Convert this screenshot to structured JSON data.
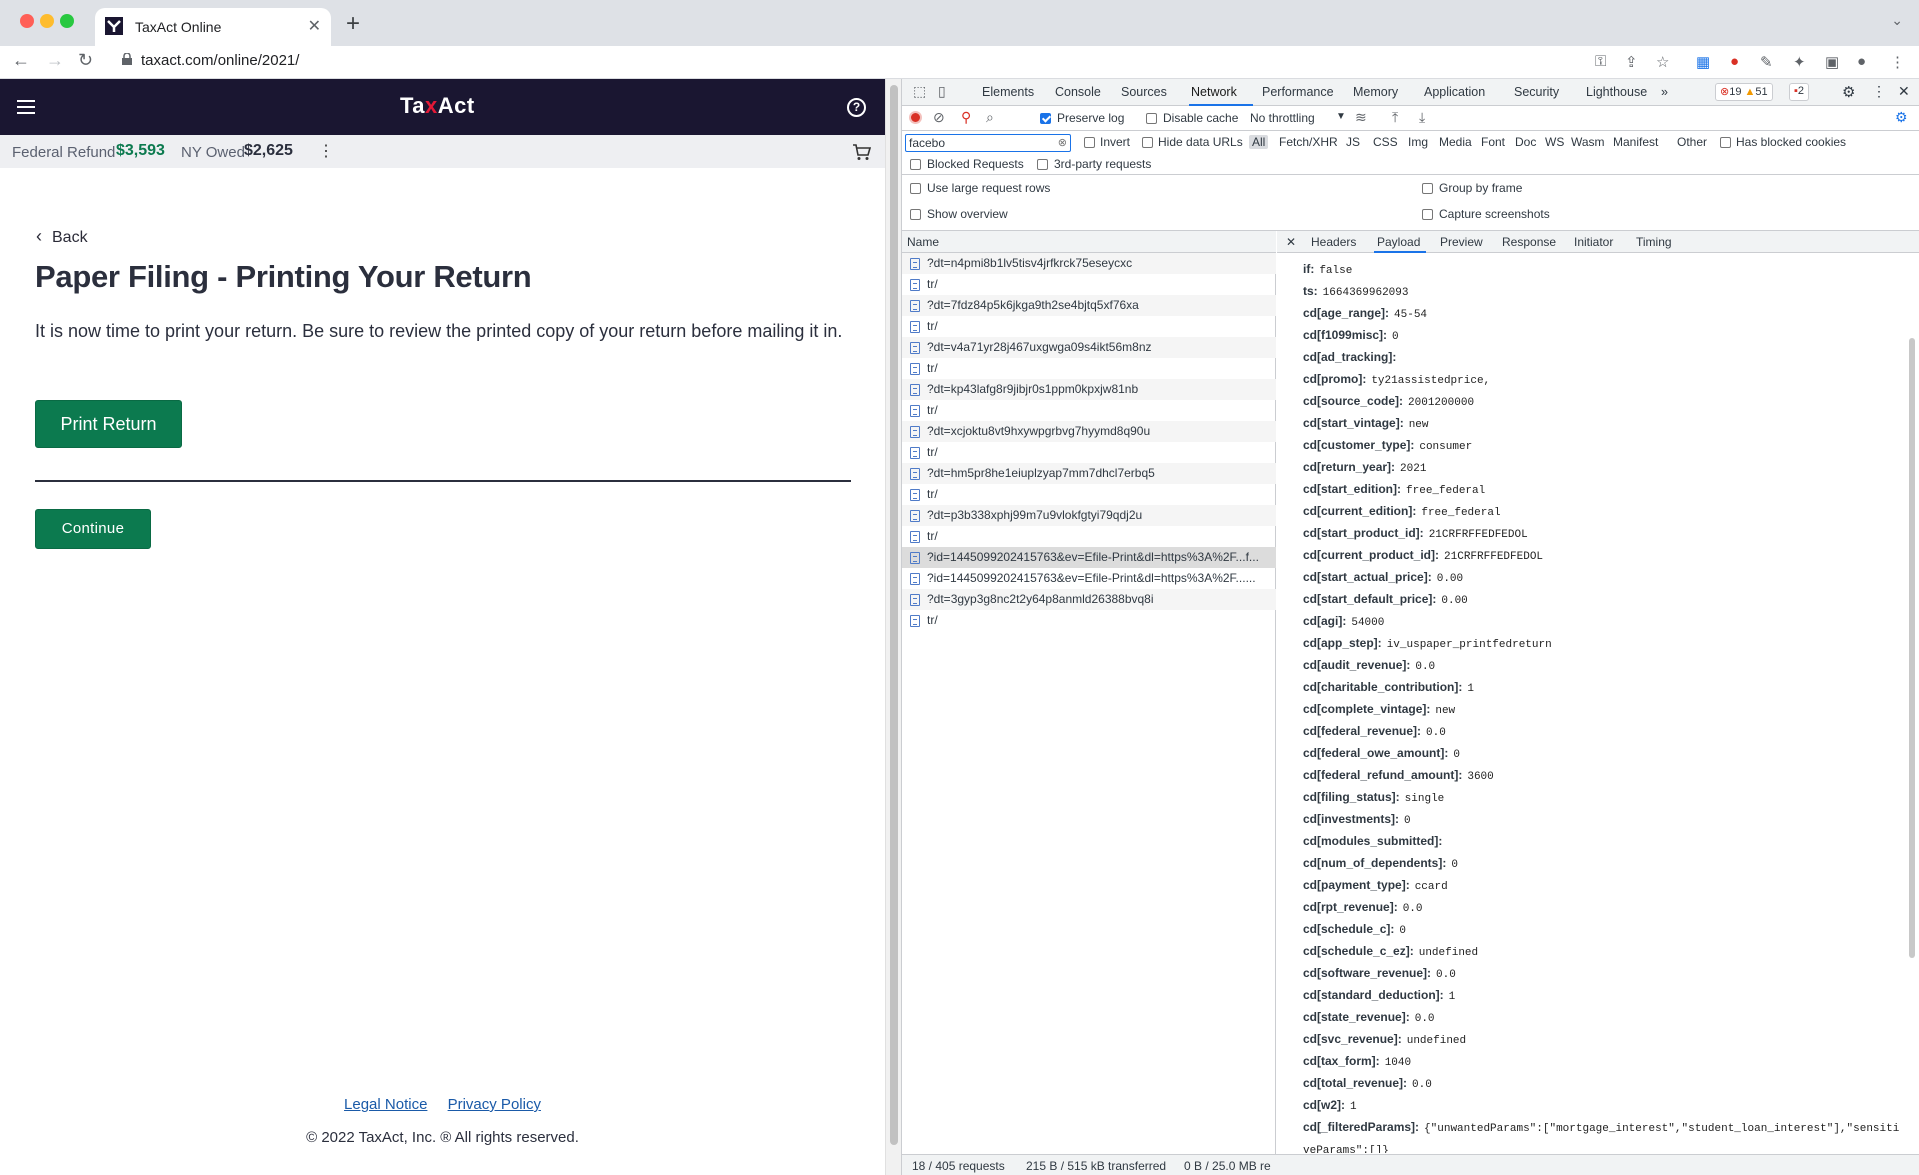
{
  "browser": {
    "tab_title": "TaxAct Online",
    "url": "taxact.com/online/2021/"
  },
  "page": {
    "logo": {
      "part1": "Ta",
      "part2": "x",
      "part3": "Act"
    },
    "federal_refund_label": "Federal Refund",
    "federal_refund_amount": "$3,593",
    "ny_label": "NY Owed",
    "ny_amount": "$2,625",
    "back_label": "Back",
    "title": "Paper Filing - Printing Your Return",
    "intro": "It is now time to print your return. Be sure to review the printed copy of your return before mailing it in.",
    "print_button": "Print Return",
    "continue_button": "Continue",
    "legal_notice": "Legal Notice",
    "privacy_policy": "Privacy Policy",
    "copyright": "© 2022 TaxAct, Inc. ® All rights reserved.",
    "colors": {
      "header": "#1a1631",
      "button": "#0c7a4f",
      "refund": "#0c7a4f"
    }
  },
  "devtools": {
    "tabs": [
      "Elements",
      "Console",
      "Sources",
      "Network",
      "Performance",
      "Memory",
      "Application",
      "Security",
      "Lighthouse"
    ],
    "active_tab": "Network",
    "errors": "19",
    "warnings": "51",
    "issues": "2",
    "preserve_log": "Preserve log",
    "disable_cache": "Disable cache",
    "throttling": "No throttling",
    "filter_value": "facebo",
    "invert": "Invert",
    "hide_data_urls": "Hide data URLs",
    "filter_types": [
      "All",
      "Fetch/XHR",
      "JS",
      "CSS",
      "Img",
      "Media",
      "Font",
      "Doc",
      "WS",
      "Wasm",
      "Manifest",
      "Other"
    ],
    "has_blocked_cookies": "Has blocked cookies",
    "blocked_requests": "Blocked Requests",
    "third_party": "3rd-party requests",
    "large_rows": "Use large request rows",
    "group_by_frame": "Group by frame",
    "show_overview": "Show overview",
    "capture_screenshots": "Capture screenshots",
    "name_header": "Name",
    "requests": [
      "?dt=n4pmi8b1lv5tisv4jrfkrck75eseycxc",
      "tr/",
      "?dt=7fdz84p5k6jkga9th2se4bjtq5xf76xa",
      "tr/",
      "?dt=v4a71yr28j467uxgwga09s4ikt56m8nz",
      "tr/",
      "?dt=kp43lafg8r9jibjr0s1ppm0kpxjw81nb",
      "tr/",
      "?dt=xcjoktu8vt9hxywpgrbvg7hyymd8q90u",
      "tr/",
      "?dt=hm5pr8he1eiuplzyap7mm7dhcl7erbq5",
      "tr/",
      "?dt=p3b338xphj99m7u9vlokfgtyi79qdj2u",
      "tr/",
      "?id=1445099202415763&ev=Efile-Print&dl=https%3A%2F...f...",
      "?id=1445099202415763&ev=Efile-Print&dl=https%3A%2F......",
      "?dt=3gyp3g8nc2t2y64p8anmld26388bvq8i",
      "tr/"
    ],
    "detail_tabs": [
      "Headers",
      "Payload",
      "Preview",
      "Response",
      "Initiator",
      "Timing"
    ],
    "active_detail_tab": "Payload",
    "payload": [
      [
        "if:",
        "false"
      ],
      [
        "ts:",
        "1664369962093"
      ],
      [
        "cd[age_range]:",
        "45-54"
      ],
      [
        "cd[f1099misc]:",
        "0"
      ],
      [
        "cd[ad_tracking]:",
        ""
      ],
      [
        "cd[promo]:",
        "ty21assistedprice,"
      ],
      [
        "cd[source_code]:",
        "2001200000"
      ],
      [
        "cd[start_vintage]:",
        "new"
      ],
      [
        "cd[customer_type]:",
        "consumer"
      ],
      [
        "cd[return_year]:",
        "2021"
      ],
      [
        "cd[start_edition]:",
        "free_federal"
      ],
      [
        "cd[current_edition]:",
        "free_federal"
      ],
      [
        "cd[start_product_id]:",
        "21CRFRFFEDFEDOL"
      ],
      [
        "cd[current_product_id]:",
        "21CRFRFFEDFEDOL"
      ],
      [
        "cd[start_actual_price]:",
        "0.00"
      ],
      [
        "cd[start_default_price]:",
        "0.00"
      ],
      [
        "cd[agi]:",
        "54000"
      ],
      [
        "cd[app_step]:",
        "iv_uspaper_printfedreturn"
      ],
      [
        "cd[audit_revenue]:",
        "0.0"
      ],
      [
        "cd[charitable_contribution]:",
        "1"
      ],
      [
        "cd[complete_vintage]:",
        "new"
      ],
      [
        "cd[federal_revenue]:",
        "0.0"
      ],
      [
        "cd[federal_owe_amount]:",
        "0"
      ],
      [
        "cd[federal_refund_amount]:",
        "3600"
      ],
      [
        "cd[filing_status]:",
        "single"
      ],
      [
        "cd[investments]:",
        "0"
      ],
      [
        "cd[modules_submitted]:",
        ""
      ],
      [
        "cd[num_of_dependents]:",
        "0"
      ],
      [
        "cd[payment_type]:",
        "ccard"
      ],
      [
        "cd[rpt_revenue]:",
        "0.0"
      ],
      [
        "cd[schedule_c]:",
        "0"
      ],
      [
        "cd[schedule_c_ez]:",
        "undefined"
      ],
      [
        "cd[software_revenue]:",
        "0.0"
      ],
      [
        "cd[standard_deduction]:",
        "1"
      ],
      [
        "cd[state_revenue]:",
        "0.0"
      ],
      [
        "cd[svc_revenue]:",
        "undefined"
      ],
      [
        "cd[tax_form]:",
        "1040"
      ],
      [
        "cd[total_revenue]:",
        "0.0"
      ],
      [
        "cd[w2]:",
        "1"
      ],
      [
        "cd[_filteredParams]:",
        "{\"unwantedParams\":[\"mortgage_interest\",\"student_loan_interest\"],\"sensiti"
      ],
      [
        "",
        "veParams\":[]}"
      ]
    ],
    "status_requests": "18 / 405 requests",
    "status_transferred": "215 B / 515 kB transferred",
    "status_resources": "0 B / 25.0 MB re"
  }
}
